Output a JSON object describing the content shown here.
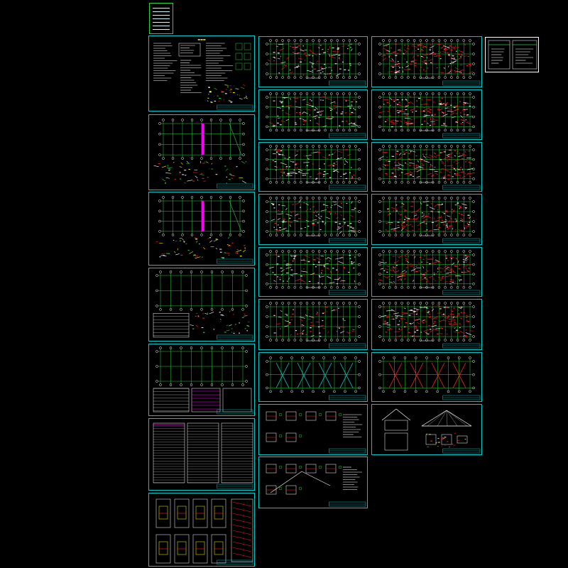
{
  "document": {
    "sheets": [
      {
        "id": "s-notes",
        "kind": "notes",
        "accent": "#ffffff"
      },
      {
        "id": "s-found1",
        "kind": "plan-detail",
        "accent": "#ff00ff"
      },
      {
        "id": "s-found2",
        "kind": "plan-detail",
        "accent": "#ff00ff"
      },
      {
        "id": "s-col1",
        "kind": "plan-table",
        "accent": "#ffffff"
      },
      {
        "id": "s-col2",
        "kind": "plan-table",
        "accent": "#ff00ff"
      },
      {
        "id": "s-table",
        "kind": "table",
        "accent": "#ffffff"
      },
      {
        "id": "s-stair",
        "kind": "stair",
        "accent": "#ffff00"
      },
      {
        "id": "s-beam1",
        "kind": "plan-dense",
        "accent": "#ff2020"
      },
      {
        "id": "s-beam2",
        "kind": "plan-dense",
        "accent": "#ff2020"
      },
      {
        "id": "s-beam3",
        "kind": "plan-dense",
        "accent": "#ff2020"
      },
      {
        "id": "s-beam4",
        "kind": "plan-dense",
        "accent": "#ff2020"
      },
      {
        "id": "s-beam5",
        "kind": "plan-dense",
        "accent": "#ff2020"
      },
      {
        "id": "s-beam6",
        "kind": "plan-dense",
        "accent": "#ffffff"
      },
      {
        "id": "s-roof1",
        "kind": "plan-sparse",
        "accent": "#00c8c8"
      },
      {
        "id": "s-det1",
        "kind": "details",
        "accent": "#ffffff"
      },
      {
        "id": "s-det2",
        "kind": "details",
        "accent": "#ffffff"
      },
      {
        "id": "s-slab1",
        "kind": "plan-slab",
        "accent": "#ff2020"
      },
      {
        "id": "s-slab2",
        "kind": "plan-slab",
        "accent": "#ff2020"
      },
      {
        "id": "s-slab3",
        "kind": "plan-slab",
        "accent": "#ff2020"
      },
      {
        "id": "s-slab4",
        "kind": "plan-slab",
        "accent": "#ff2020"
      },
      {
        "id": "s-slab5",
        "kind": "plan-slab",
        "accent": "#ff2020"
      },
      {
        "id": "s-slab6",
        "kind": "plan-slab",
        "accent": "#ff2020"
      },
      {
        "id": "s-roof2",
        "kind": "plan-sparse",
        "accent": "#ff2020"
      },
      {
        "id": "s-elev",
        "kind": "elevation",
        "accent": "#ffffff"
      },
      {
        "id": "s-legend",
        "kind": "legend",
        "accent": "#ffffff"
      }
    ],
    "colors": {
      "background": "#000000",
      "frame": "#00c8c8",
      "grid": "#2ecc40",
      "axis": "#ffffff",
      "rebar": "#ff2020",
      "column": "#ff00ff",
      "title": "#ffff00"
    }
  }
}
